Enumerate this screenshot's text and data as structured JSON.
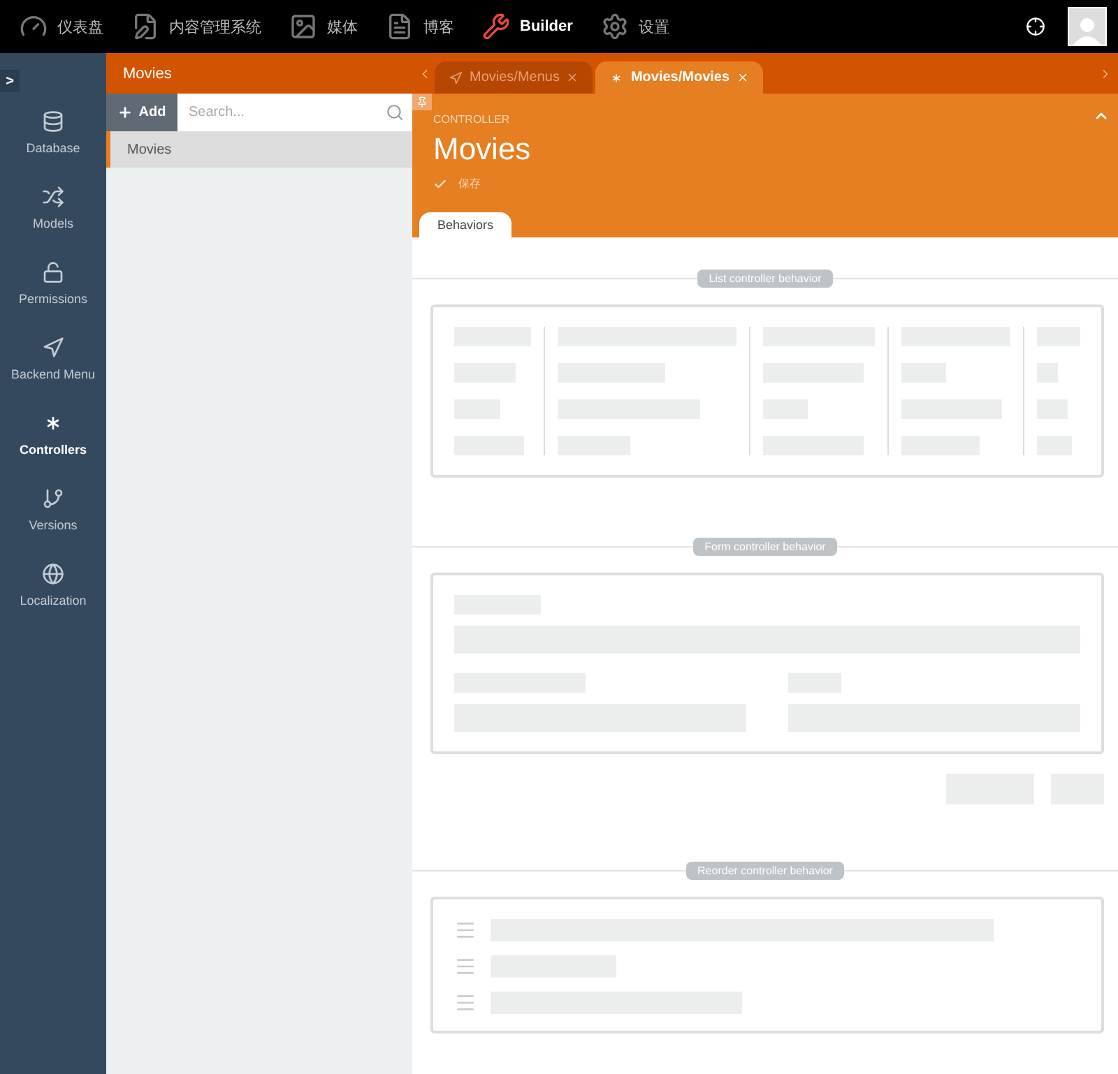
{
  "top_menu": [
    {
      "label": "仪表盘",
      "selected": false
    },
    {
      "label": "内容管理系统",
      "selected": false
    },
    {
      "label": "媒体",
      "selected": false
    },
    {
      "label": "博客",
      "selected": false
    },
    {
      "label": "Builder",
      "selected": true
    },
    {
      "label": "设置",
      "selected": false
    }
  ],
  "sidebar": {
    "toggle": ">",
    "items": [
      {
        "label": "Database",
        "selected": false
      },
      {
        "label": "Models",
        "selected": false
      },
      {
        "label": "Permissions",
        "selected": false
      },
      {
        "label": "Backend Menu",
        "selected": false
      },
      {
        "label": "Controllers",
        "selected": true
      },
      {
        "label": "Versions",
        "selected": false
      },
      {
        "label": "Localization",
        "selected": false
      }
    ]
  },
  "list_panel": {
    "title": "Movies",
    "add_button": "Add",
    "search": {
      "placeholder": "Search..."
    },
    "items": [
      {
        "label": "Movies",
        "selected": true
      }
    ]
  },
  "tabs": [
    {
      "label": "Movies/Menus",
      "selected": false
    },
    {
      "label": "Movies/Movies",
      "selected": true
    }
  ],
  "header": {
    "subtitle": "CONTROLLER",
    "title": "Movies",
    "save": "保存",
    "tabs": [
      {
        "label": "Behaviors",
        "selected": true
      }
    ]
  },
  "behaviors": [
    {
      "kind": "list",
      "label": "List controller behavior"
    },
    {
      "kind": "form",
      "label": "Form controller behavior"
    },
    {
      "kind": "reorder",
      "label": "Reorder controller behavior"
    }
  ]
}
